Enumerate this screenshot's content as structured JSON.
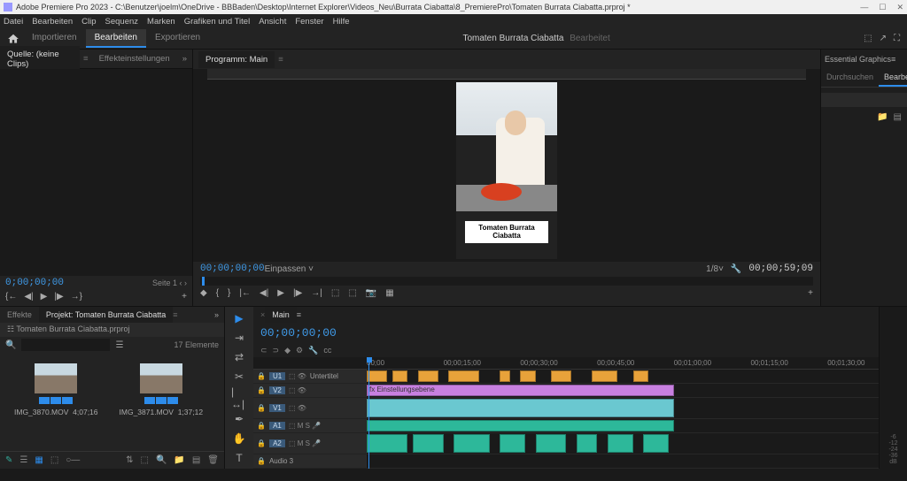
{
  "titlebar": {
    "title": "Adobe Premiere Pro 2023 - C:\\Benutzer\\joelm\\OneDrive - BBBaden\\Desktop\\Internet Explorer\\Videos_Neu\\Burrata Ciabatta\\8_PremierePro\\Tomaten Burrata Ciabatta.prproj *"
  },
  "menu": {
    "items": [
      "Datei",
      "Bearbeiten",
      "Clip",
      "Sequenz",
      "Marken",
      "Grafiken und Titel",
      "Ansicht",
      "Fenster",
      "Hilfe"
    ]
  },
  "workspace": {
    "tabs": [
      "Importieren",
      "Bearbeiten",
      "Exportieren"
    ],
    "active": 1,
    "project_title": "Tomaten Burrata Ciabatta",
    "status": "Bearbeitet"
  },
  "source_panel": {
    "tab_label": "Quelle: (keine Clips)",
    "secondary_tab": "Effekteinstellungen",
    "timecode": "0;00;00;00",
    "page_label": "Seite 1"
  },
  "effects_panel": {
    "tab1": "Effekte",
    "tab2": "Projekt: Tomaten Burrata Ciabatta"
  },
  "program_panel": {
    "tab_label": "Programm: Main",
    "overlay_text": "Tomaten Burrata Ciabatta",
    "timecode_in": "00;00;00;00",
    "fit": "Einpassen",
    "zoom": "1/8",
    "timecode_out": "00;00;59;09"
  },
  "graphics_panel": {
    "title": "Essential Graphics",
    "tab_browse": "Durchsuchen",
    "tab_edit": "Bearbeı"
  },
  "project_browser": {
    "breadcrumb": "Tomaten Burrata Ciabatta.prproj",
    "search_placeholder": "",
    "item_count": "17 Elemente",
    "items": [
      {
        "name": "IMG_3870.MOV",
        "dur": "4;07;16"
      },
      {
        "name": "IMG_3871.MOV",
        "dur": "1;37;12"
      }
    ]
  },
  "timeline": {
    "tab_label": "Main",
    "timecode": "00;00;00;00",
    "ruler_ticks": [
      "00;00",
      "00;00;15;00",
      "00;00;30;00",
      "00;00;45;00",
      "00;01;00;00",
      "00;01;15;00",
      "00;01;30;00"
    ],
    "tracks_video": [
      {
        "id": "U1",
        "label": "Untertitel"
      },
      {
        "id": "V2",
        "label": ""
      },
      {
        "id": "V1",
        "label": ""
      }
    ],
    "tracks_audio": [
      {
        "id": "A1",
        "label": ""
      },
      {
        "id": "A2",
        "label": ""
      },
      {
        "id": "",
        "label": "Audio 3"
      }
    ],
    "clip_label_v2": "fx  Einstellungsebene"
  },
  "audio_meter": {
    "label": "dB"
  }
}
